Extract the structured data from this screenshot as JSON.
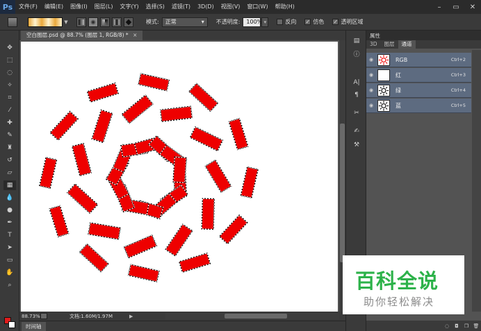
{
  "menubar": {
    "logo": "Ps",
    "items": [
      "文件(F)",
      "编辑(E)",
      "图像(I)",
      "图层(L)",
      "文字(Y)",
      "选择(S)",
      "滤镜(T)",
      "3D(D)",
      "视图(V)",
      "窗口(W)",
      "帮助(H)"
    ],
    "window_controls": [
      "–",
      "▭",
      "✕"
    ]
  },
  "options": {
    "mode_label": "模式:",
    "mode_value": "正常",
    "opacity_label": "不透明度:",
    "opacity_value": "100%",
    "reverse_label": "反向",
    "dither_label": "仿色",
    "transparency_label": "透明区域",
    "reverse_checked": false,
    "dither_checked": true,
    "transparency_checked": true
  },
  "document": {
    "tab_title": "空白图层.psd @ 88.7% (图层 1, RGB/8) *",
    "tab_close": "×",
    "zoom": "88.73%",
    "doc_info": "文档:1.60M/1.97M",
    "status_arrow": "▶",
    "timeline_label": "时间轴"
  },
  "colors": {
    "foreground": "#e11c1c",
    "background": "#ffffff",
    "shape_fill": "#ee0000",
    "panel_selected": "#5d6b80"
  },
  "panel": {
    "header": "属性",
    "tabs": [
      "3D",
      "图层",
      "通道"
    ],
    "active_tab": 2,
    "channels": [
      {
        "name": "RGB",
        "key": "Ctrl+2"
      },
      {
        "name": "红",
        "key": "Ctrl+3"
      },
      {
        "name": "绿",
        "key": "Ctrl+4"
      },
      {
        "name": "蓝",
        "key": "Ctrl+5"
      }
    ]
  },
  "watermark": {
    "title": "百科全说",
    "subtitle": "助你轻松解决"
  },
  "tool_icons": [
    "move-icon",
    "marquee-icon",
    "lasso-icon",
    "magic-wand-icon",
    "crop-icon",
    "eyedropper-icon",
    "healing-brush-icon",
    "brush-icon",
    "clone-stamp-icon",
    "history-brush-icon",
    "eraser-icon",
    "gradient-icon",
    "blur-icon",
    "dodge-icon",
    "pen-icon",
    "type-icon",
    "path-select-icon",
    "shape-icon",
    "hand-icon",
    "zoom-icon"
  ]
}
